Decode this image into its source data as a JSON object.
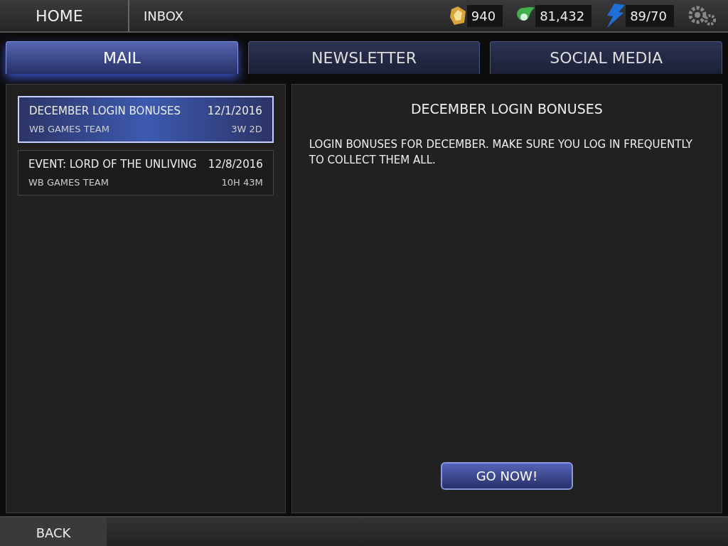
{
  "header": {
    "home": "HOME",
    "breadcrumb": "INBOX",
    "currencies": [
      {
        "kind": "gem",
        "amount": "940"
      },
      {
        "kind": "orb",
        "amount": "81,432"
      },
      {
        "kind": "energy",
        "amount": "89/70"
      }
    ]
  },
  "tabs": [
    {
      "label": "MAIL",
      "selected": true
    },
    {
      "label": "NEWSLETTER",
      "selected": false
    },
    {
      "label": "SOCIAL MEDIA",
      "selected": false
    }
  ],
  "messages": [
    {
      "title": "DECEMBER LOGIN BONUSES",
      "date": "12/1/2016",
      "sender": "WB GAMES TEAM",
      "age": "3W 2D",
      "selected": true
    },
    {
      "title": "EVENT: LORD OF THE UNLIVING",
      "date": "12/8/2016",
      "sender": "WB GAMES TEAM",
      "age": "10H 43M",
      "selected": false
    }
  ],
  "detail": {
    "title": "DECEMBER LOGIN BONUSES",
    "body": "LOGIN BONUSES FOR DECEMBER. MAKE SURE YOU LOG IN FREQUENTLY TO COLLECT THEM ALL.",
    "button": "GO NOW!"
  },
  "footer": {
    "back": "BACK"
  }
}
